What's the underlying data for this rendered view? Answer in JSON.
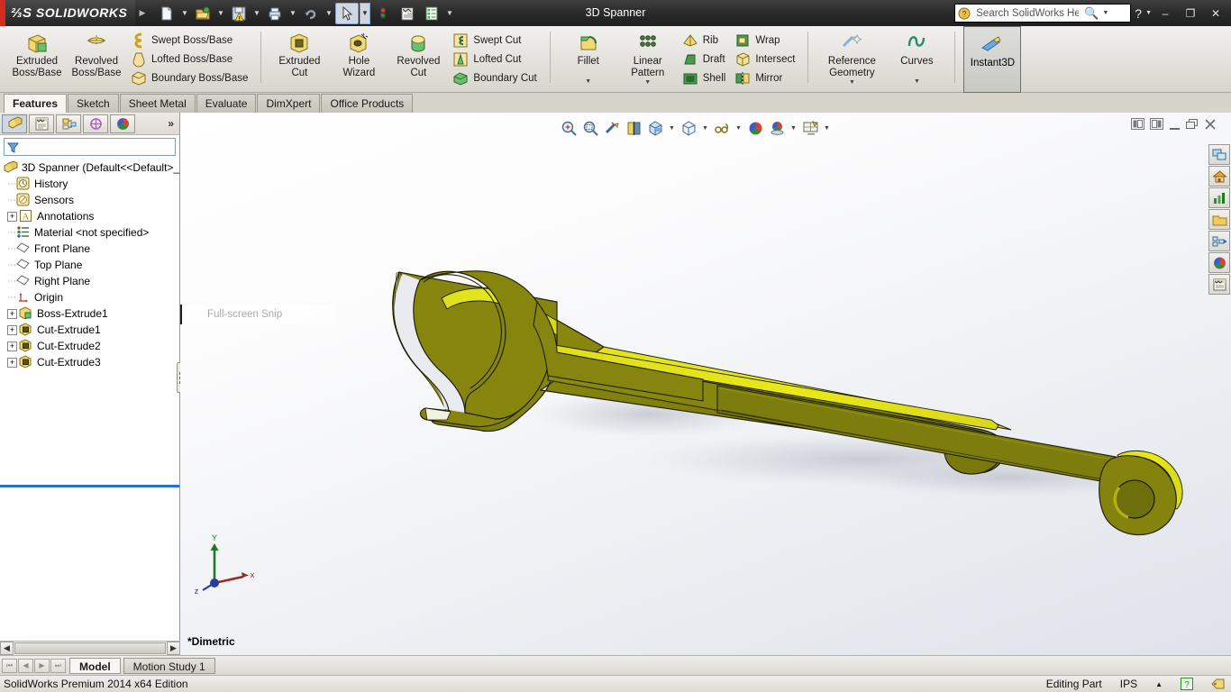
{
  "window": {
    "brand": "SOLIDWORKS",
    "title": "3D Spanner",
    "minimize": "–",
    "restore": "❐",
    "close": "✕"
  },
  "search": {
    "placeholder": "Search SolidWorks Help",
    "value": "",
    "icon": "search-icon"
  },
  "quick_access": [
    {
      "name": "new-document",
      "icon": "new-document-icon",
      "has_dropdown": true
    },
    {
      "name": "open-document",
      "icon": "open-folder-icon",
      "has_dropdown": true
    },
    {
      "name": "save-document",
      "icon": "save-warning-icon",
      "has_dropdown": true
    },
    {
      "name": "print-document",
      "icon": "printer-icon",
      "has_dropdown": true
    },
    {
      "name": "undo",
      "icon": "undo-arrow-icon",
      "has_dropdown": true
    },
    {
      "name": "select",
      "icon": "cursor-arrow-icon",
      "has_dropdown": true,
      "selected": true
    },
    {
      "name": "rebuild",
      "icon": "traffic-light-icon",
      "has_dropdown": false
    },
    {
      "name": "options",
      "icon": "options-gear-icon",
      "has_dropdown": false
    },
    {
      "name": "customize",
      "icon": "list-icon",
      "has_dropdown": true
    }
  ],
  "ribbon": {
    "groups": [
      {
        "name": "boss-base-group",
        "big_buttons": [
          {
            "label_line1": "Extruded",
            "label_line2": "Boss/Base",
            "icon": "extruded-boss-icon"
          },
          {
            "label_line1": "Revolved",
            "label_line2": "Boss/Base",
            "icon": "revolved-boss-icon"
          }
        ],
        "stack": [
          {
            "label": "Swept Boss/Base",
            "icon": "swept-boss-icon"
          },
          {
            "label": "Lofted Boss/Base",
            "icon": "lofted-boss-icon"
          },
          {
            "label": "Boundary Boss/Base",
            "icon": "boundary-boss-icon"
          }
        ]
      },
      {
        "name": "cut-group",
        "big_buttons": [
          {
            "label_line1": "Extruded",
            "label_line2": "Cut",
            "icon": "extruded-cut-icon"
          },
          {
            "label_line1": "Hole",
            "label_line2": "Wizard",
            "icon": "hole-wizard-icon"
          },
          {
            "label_line1": "Revolved",
            "label_line2": "Cut",
            "icon": "revolved-cut-icon"
          }
        ],
        "stack": [
          {
            "label": "Swept Cut",
            "icon": "swept-cut-icon"
          },
          {
            "label": "Lofted Cut",
            "icon": "lofted-cut-icon"
          },
          {
            "label": "Boundary Cut",
            "icon": "boundary-cut-icon"
          }
        ]
      },
      {
        "name": "features-group",
        "big_buttons": [
          {
            "label_line1": "Fillet",
            "label_line2": "",
            "icon": "fillet-icon",
            "dropdown": "▼"
          },
          {
            "label_line1": "Linear",
            "label_line2": "Pattern",
            "icon": "linear-pattern-icon",
            "dropdown": "▼"
          }
        ],
        "stack": [
          {
            "label": "Rib",
            "icon": "rib-icon"
          },
          {
            "label": "Draft",
            "icon": "draft-icon"
          },
          {
            "label": "Shell",
            "icon": "shell-icon"
          }
        ],
        "stack2": [
          {
            "label": "Wrap",
            "icon": "wrap-icon"
          },
          {
            "label": "Intersect",
            "icon": "intersect-icon"
          },
          {
            "label": "Mirror",
            "icon": "mirror-icon"
          }
        ]
      },
      {
        "name": "reference-group",
        "big_buttons": [
          {
            "label_line1": "Reference",
            "label_line2": "Geometry",
            "icon": "reference-geometry-icon",
            "dropdown": "▼"
          },
          {
            "label_line1": "Curves",
            "label_line2": "",
            "icon": "curves-icon",
            "dropdown": "▼"
          }
        ]
      }
    ],
    "instant3d": {
      "label": "Instant3D",
      "icon": "instant3d-icon",
      "active": true
    }
  },
  "command_tabs": [
    {
      "label": "Features",
      "active": true
    },
    {
      "label": "Sketch",
      "active": false
    },
    {
      "label": "Sheet Metal",
      "active": false
    },
    {
      "label": "Evaluate",
      "active": false
    },
    {
      "label": "DimXpert",
      "active": false
    },
    {
      "label": "Office Products",
      "active": false
    }
  ],
  "feature_manager": {
    "tabs": [
      {
        "name": "feature-manager-tab",
        "icon": "feature-tree-icon",
        "active": true
      },
      {
        "name": "property-manager-tab",
        "icon": "property-manager-icon",
        "active": false
      },
      {
        "name": "configuration-manager-tab",
        "icon": "configuration-icon",
        "active": false
      },
      {
        "name": "dimxpert-manager-tab",
        "icon": "dimxpert-icon",
        "active": false
      },
      {
        "name": "display-manager-tab",
        "icon": "display-manager-icon",
        "active": false
      }
    ],
    "more_tabs": "»",
    "filter_placeholder": "",
    "tree": [
      {
        "label": "3D Spanner  (Default<<Default>_",
        "icon": "part-icon",
        "level": 0,
        "expandable": false
      },
      {
        "label": "History",
        "icon": "history-icon",
        "level": 1,
        "expandable": false
      },
      {
        "label": "Sensors",
        "icon": "sensors-icon",
        "level": 1,
        "expandable": false
      },
      {
        "label": "Annotations",
        "icon": "annotations-icon",
        "level": 1,
        "expandable": true
      },
      {
        "label": "Material <not specified>",
        "icon": "material-icon",
        "level": 1,
        "expandable": false
      },
      {
        "label": "Front Plane",
        "icon": "plane-icon",
        "level": 1,
        "expandable": false
      },
      {
        "label": "Top Plane",
        "icon": "plane-icon",
        "level": 1,
        "expandable": false
      },
      {
        "label": "Right Plane",
        "icon": "plane-icon",
        "level": 1,
        "expandable": false
      },
      {
        "label": "Origin",
        "icon": "origin-icon",
        "level": 1,
        "expandable": false
      },
      {
        "label": "Boss-Extrude1",
        "icon": "boss-extrude-icon",
        "level": 1,
        "expandable": true
      },
      {
        "label": "Cut-Extrude1",
        "icon": "cut-extrude-icon",
        "level": 1,
        "expandable": true
      },
      {
        "label": "Cut-Extrude2",
        "icon": "cut-extrude-icon",
        "level": 1,
        "expandable": true
      },
      {
        "label": "Cut-Extrude3",
        "icon": "cut-extrude-icon",
        "level": 1,
        "expandable": true
      }
    ]
  },
  "view_toolbar": [
    {
      "name": "zoom-to-fit",
      "icon": "zoom-to-fit-icon",
      "dropdown": false
    },
    {
      "name": "zoom-to-area",
      "icon": "zoom-to-area-icon",
      "dropdown": false
    },
    {
      "name": "previous-view",
      "icon": "previous-view-icon",
      "dropdown": false
    },
    {
      "name": "section-view",
      "icon": "section-view-icon",
      "dropdown": false
    },
    {
      "name": "view-orientation",
      "icon": "view-orientation-icon",
      "dropdown": true
    },
    {
      "name": "display-style",
      "icon": "display-style-icon",
      "dropdown": true
    },
    {
      "name": "hide-show-items",
      "icon": "glasses-icon",
      "dropdown": true
    },
    {
      "name": "apply-scene",
      "icon": "scene-sphere-icon",
      "dropdown": false
    },
    {
      "name": "view-settings",
      "icon": "view-settings-icon",
      "dropdown": true
    },
    {
      "name": "viewport",
      "icon": "viewport-icon",
      "dropdown": true
    }
  ],
  "doc_window_buttons": [
    {
      "name": "tile-left-icon"
    },
    {
      "name": "tile-right-icon"
    },
    {
      "name": "minimize-doc-icon"
    },
    {
      "name": "restore-doc-icon"
    },
    {
      "name": "close-doc-icon"
    }
  ],
  "right_dock": [
    {
      "name": "view-palette-icon"
    },
    {
      "name": "appearances-home-icon"
    },
    {
      "name": "scenes-lights-icon"
    },
    {
      "name": "file-explorer-icon"
    },
    {
      "name": "design-library-icon"
    },
    {
      "name": "display-manager-pane-icon"
    },
    {
      "name": "custom-properties-icon"
    }
  ],
  "graphics": {
    "snip_ghost_label": "Full-screen Snip",
    "view_label": "*Dimetric",
    "triad_axes": {
      "x": "x",
      "y": "Y",
      "z": "z"
    },
    "model": {
      "name": "3D Spanner",
      "body_color": "#8a8a0e",
      "highlight_color": "#e6e617",
      "edge_color": "#2b2b00"
    }
  },
  "study_bar": {
    "nav": [
      "⏮",
      "◀",
      "▶",
      "⏭"
    ],
    "tabs": [
      {
        "label": "Model",
        "active": true
      },
      {
        "label": "Motion Study 1",
        "active": false
      }
    ]
  },
  "status_bar": {
    "edition": "SolidWorks Premium 2014 x64 Edition",
    "mode": "Editing Part",
    "units": "IPS",
    "units_arrow": "▲",
    "help_icon": "help-question-icon",
    "tag_icon": "tag-icon"
  }
}
